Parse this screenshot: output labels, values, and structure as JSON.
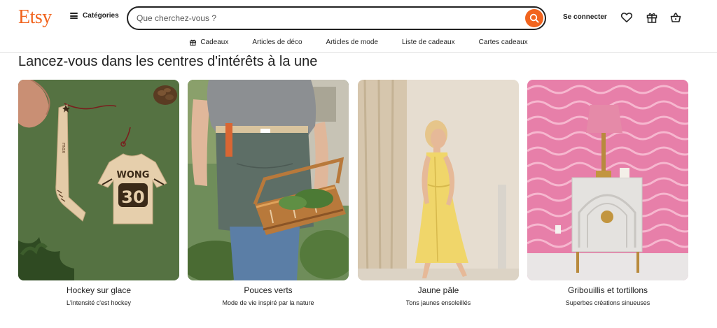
{
  "header": {
    "logo": "Etsy",
    "categories_label": "Catégories",
    "search_placeholder": "Que cherchez-vous ?",
    "signin_label": "Se connecter"
  },
  "subnav": {
    "items": [
      {
        "label": "Cadeaux",
        "icon": "gift-icon"
      },
      {
        "label": "Articles de déco"
      },
      {
        "label": "Articles de mode"
      },
      {
        "label": "Liste de cadeaux"
      },
      {
        "label": "Cartes cadeaux"
      }
    ]
  },
  "section": {
    "title": "Lancez-vous dans les centres d'intérêts à la une",
    "cards": [
      {
        "title": "Hockey sur glace",
        "subtitle": "L'intensité c'est hockey",
        "ornament_name": "WONG",
        "ornament_number": "30",
        "stick_text": "max"
      },
      {
        "title": "Pouces verts",
        "subtitle": "Mode de vie inspiré par la nature"
      },
      {
        "title": "Jaune pâle",
        "subtitle": "Tons jaunes ensoleillés"
      },
      {
        "title": "Gribouillis et tortillons",
        "subtitle": "Superbes créations sinueuses"
      }
    ]
  },
  "colors": {
    "accent": "#f1641e",
    "text": "#222222"
  }
}
